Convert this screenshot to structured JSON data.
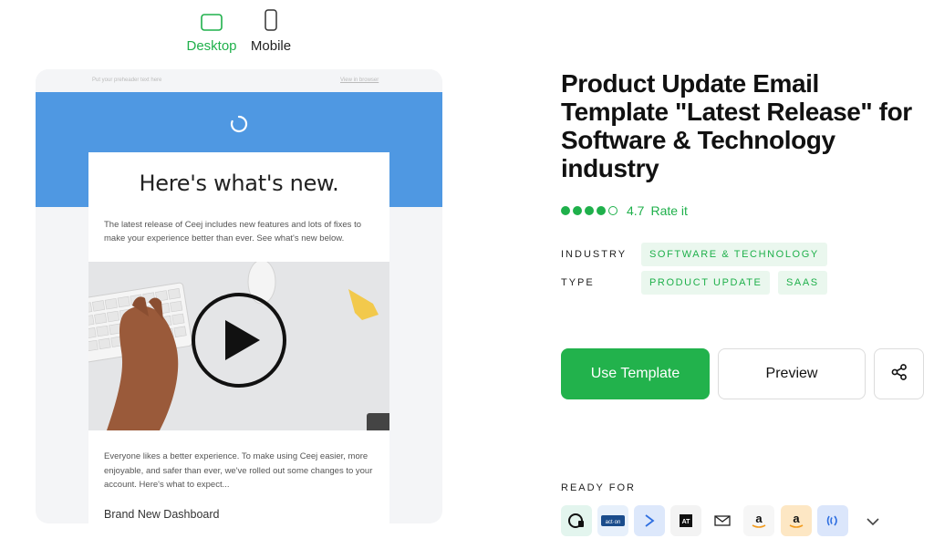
{
  "device_toggle": {
    "desktop_label": "Desktop",
    "mobile_label": "Mobile",
    "active": "Desktop",
    "active_color": "#1fb04b"
  },
  "email_preview": {
    "preheader_text": "Put your preheader text here",
    "view_in_browser": "View in browser",
    "banner_color": "#4f98e2",
    "logo_icon": "loading-arc-icon",
    "headline": "Here's what's new.",
    "intro": "The latest release of Ceej includes new features and lots of fixes to make your experience better than ever. See what's new below.",
    "video_icon": "play-icon",
    "body": "Everyone likes a better experience. To make using Ceej easier, more enjoyable, and safer than ever, we've rolled out some changes to your account. Here's what to expect...",
    "section_heading": "Brand New Dashboard"
  },
  "details": {
    "title": "Product Update Email Template \"Latest Release\" for Software & Technology industry",
    "rating": {
      "value": "4.7",
      "filled": 4,
      "total": 5,
      "rate_label": "Rate it"
    },
    "industry_label": "INDUSTRY",
    "industry_tags": [
      "SOFTWARE & TECHNOLOGY"
    ],
    "type_label": "TYPE",
    "type_tags": [
      "PRODUCT UPDATE",
      "SAAS"
    ],
    "use_template_label": "Use Template",
    "preview_label": "Preview",
    "share_icon": "share-icon",
    "ready_for_label": "READY FOR",
    "esp_icons": [
      "campaign-monitor-icon",
      "act-on-icon",
      "sendgrid-arrow-icon",
      "aweber-icon",
      "mail-icon",
      "amazon-icon",
      "amazon-ses-icon",
      "wifi-wave-icon"
    ],
    "more_icon": "chevron-down-icon"
  },
  "colors": {
    "accent": "#1fb04b",
    "tag_bg": "#eaf7ee"
  }
}
